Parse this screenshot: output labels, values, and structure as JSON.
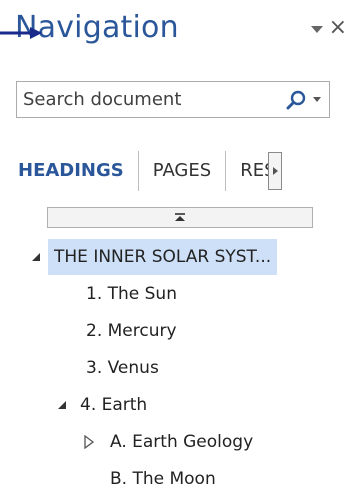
{
  "pane": {
    "title": "Navigation",
    "close_glyph": "×"
  },
  "search": {
    "placeholder": "Search document"
  },
  "tabs": [
    {
      "label": "HEADINGS",
      "active": true
    },
    {
      "label": "PAGES",
      "active": false
    },
    {
      "label": "RES",
      "active": false
    }
  ],
  "tree": {
    "items": [
      {
        "label": "THE INNER SOLAR SYST...",
        "level": 0,
        "expander": "expanded",
        "selected": true
      },
      {
        "label": "1. The Sun",
        "level": 1,
        "expander": "none",
        "selected": false
      },
      {
        "label": "2. Mercury",
        "level": 1,
        "expander": "none",
        "selected": false
      },
      {
        "label": "3. Venus",
        "level": 1,
        "expander": "none",
        "selected": false
      },
      {
        "label": "4. Earth",
        "level": 1,
        "expander": "expanded",
        "selected": false
      },
      {
        "label": "A. Earth Geology",
        "level": 2,
        "expander": "collapsed",
        "selected": false
      },
      {
        "label": "B. The Moon",
        "level": 2,
        "expander": "none",
        "selected": false
      }
    ]
  },
  "colors": {
    "accent": "#2b579a",
    "selection": "#cde0f7",
    "pointer_arrow": "#1a2a8c"
  },
  "icons": {
    "menu": "chevron-down-icon",
    "close": "close-icon",
    "search": "search-icon",
    "collapse_all": "collapse-all-icon",
    "tab_scroll": "scroll-right-icon",
    "pointer": "arrow-pointer-icon"
  }
}
